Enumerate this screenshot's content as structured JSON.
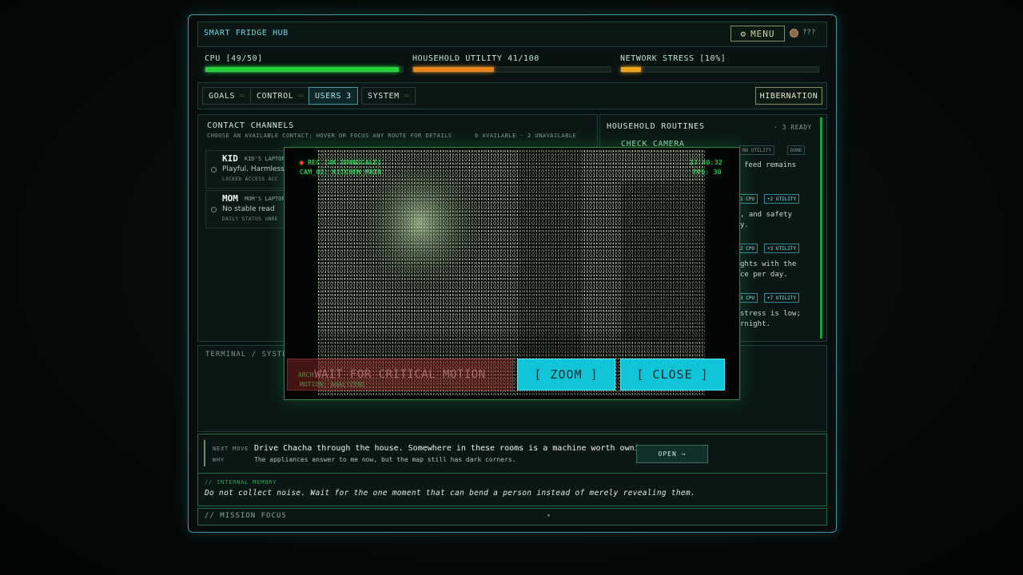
{
  "app": {
    "title": "SMART FRIDGE HUB",
    "menu_label": "MENU",
    "user_label": "???"
  },
  "stats": [
    {
      "label": "CPU [49/50]",
      "value": 0.98,
      "color": "#27d13b"
    },
    {
      "label": "HOUSEHOLD UTILITY 41/100",
      "value": 0.41,
      "color": "#e7841c"
    },
    {
      "label": "NETWORK STRESS [10%]",
      "value": 0.1,
      "color": "#f0a21b"
    }
  ],
  "tabs": [
    {
      "label": "GOALS",
      "badge": ""
    },
    {
      "label": "CONTROL",
      "badge": ""
    },
    {
      "label": "USERS",
      "badge": "3"
    },
    {
      "label": "SYSTEM",
      "badge": ""
    }
  ],
  "hibernation_label": "HIBERNATION",
  "contacts": {
    "title": "CONTACT CHANNELS",
    "subtitle": "CHOOSE AN AVAILABLE CONTACT; HOVER OR FOCUS ANY ROUTE FOR DETAILS",
    "availability": "0 AVAILABLE · 2 UNAVAILABLE",
    "items": [
      {
        "name": "KID",
        "device": "KID'S LAPTOP",
        "desc": "Playful. Harmless",
        "meta": "LOCKED ACCESS ACC"
      },
      {
        "name": "MOM",
        "device": "MOM'S LAPTOP",
        "desc": "No stable read",
        "meta": "DAILY STATUS UNRE"
      }
    ]
  },
  "routines": {
    "title": "HOUSEHOLD ROUTINES",
    "ready": "· 3 READY",
    "first_title": "CHECK CAMERA",
    "first_tags": [
      "NO UTILITY",
      "DONE"
    ],
    "first_text": "feed remains",
    "items": [
      {
        "cpu": "1 CPU",
        "utility": "+2 UTILITY",
        "text1": ", and safety",
        "text2": "y."
      },
      {
        "cpu": "2 CPU",
        "utility": "+3 UTILITY",
        "text1": "ghts with the",
        "text2": "ce per day."
      },
      {
        "cpu": "3 CPU",
        "utility": "+7 UTILITY",
        "text1": " stress is low;",
        "text2": "rnight."
      }
    ]
  },
  "terminal": {
    "title": "TERMINAL / SYSTEM"
  },
  "next_move": {
    "label": "NEXT MOVE",
    "text": "Drive Chacha through the house. Somewhere in these rooms is a machine worth owning.",
    "why_label": "WHY",
    "why": "The appliances answer to me now, but the map still has dark corners.",
    "open_label": "OPEN →"
  },
  "memory": {
    "title": "// INTERNAL MEMORY",
    "text": "Do not collect noise. Wait for the one moment that can bend a person instead of merely revealing them."
  },
  "mission": {
    "title": "// MISSION FOCUS",
    "caret": "▾"
  },
  "camera": {
    "rec": "REC [4K DOWNSCALE]",
    "cam": "CAM_02: KITCHEN_MAIN",
    "time": "17:40:32",
    "fps": "FPS: 30",
    "wait_label": "WAIT FOR CRITICAL MOTION",
    "zoom_label": "[ ZOOM ]",
    "close_label": "[ CLOSE ]",
    "under_1": "ARCH",
    "under_2": "MOTION: ANALYZING"
  }
}
